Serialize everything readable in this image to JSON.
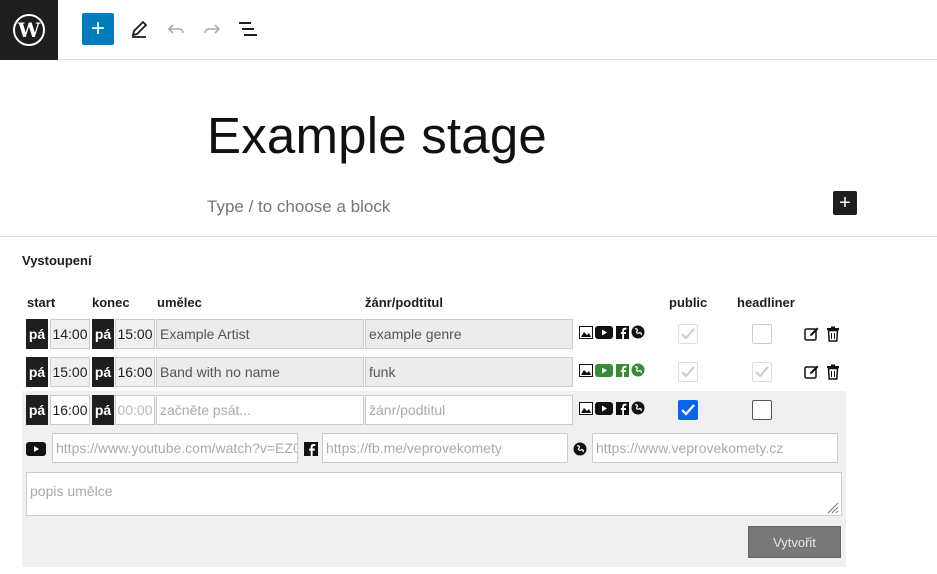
{
  "toolbar": {
    "logo": "wordpress-logo",
    "add_symbol": "+",
    "icons": [
      "pencil-icon",
      "undo-icon",
      "redo-icon",
      "document-overview-icon"
    ]
  },
  "editor": {
    "title": "Example stage",
    "block_hint": "Type / to choose a block",
    "add_symbol": "+"
  },
  "meta": {
    "title": "Vystoupení",
    "columns": {
      "start": "start",
      "end": "konec",
      "artist": "umělec",
      "genre": "žánr/podtitul",
      "public": "public",
      "headliner": "headliner"
    },
    "rows": [
      {
        "day_start": "pá",
        "start": "14:00",
        "day_end": "pá",
        "end": "15:00",
        "artist": "Example Artist",
        "genre": "example genre",
        "public": true,
        "headliner": false
      },
      {
        "day_start": "pá",
        "start": "15:00",
        "day_end": "pá",
        "end": "16:00",
        "artist": "Band with no name",
        "genre": "funk",
        "public": true,
        "headliner": true
      }
    ],
    "new_row": {
      "day_start": "pá",
      "start": "16:00",
      "day_end": "pá",
      "end_placeholder": "00:00",
      "artist_placeholder": "začněte psát...",
      "genre_placeholder": "žánr/podtitul",
      "public": true,
      "headliner": false,
      "youtube_placeholder": "https://www.youtube.com/watch?v=EZ0",
      "facebook_placeholder": "https://fb.me/veprovekomety",
      "web_placeholder": "https://www.veprovekomety.cz",
      "description_placeholder": "popis umělce",
      "create_label": "Vytvořit"
    },
    "colors": {
      "accent": "#007cba",
      "active_media": "#3a8a3a",
      "checkbox_checked": "#0b63e5"
    }
  }
}
